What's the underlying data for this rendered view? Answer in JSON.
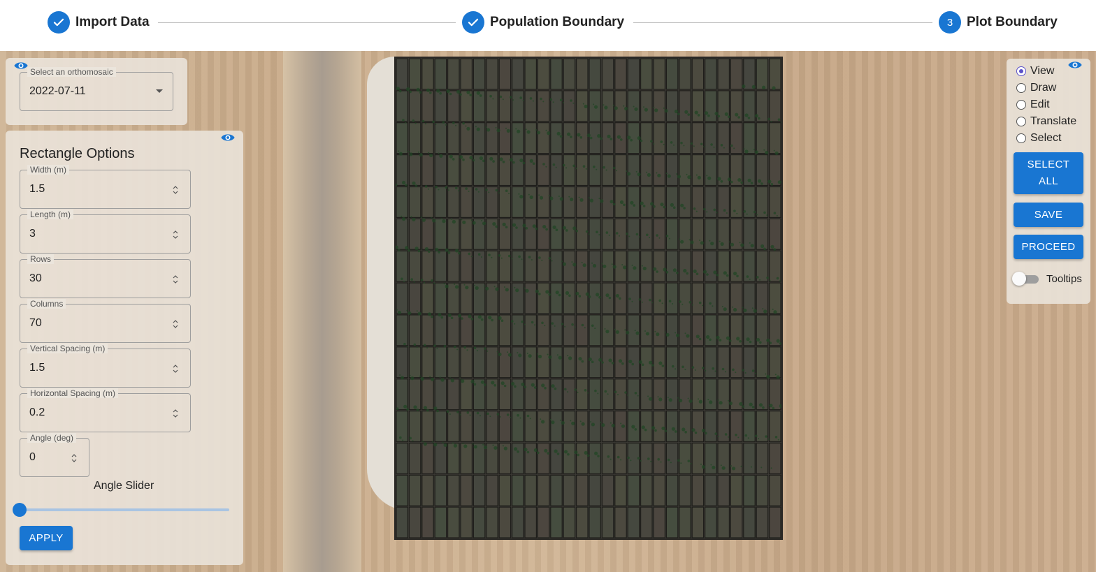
{
  "stepper": {
    "steps": [
      {
        "label": "Import Data",
        "state": "completed"
      },
      {
        "label": "Population Boundary",
        "state": "completed"
      },
      {
        "label": "Plot Boundary",
        "state": "active",
        "number": "3"
      }
    ]
  },
  "orthomosaic": {
    "label": "Select an orthomosaic",
    "value": "2022-07-11"
  },
  "rectangle_options": {
    "title": "Rectangle Options",
    "fields": [
      {
        "label": "Width (m)",
        "value": "1.5"
      },
      {
        "label": "Length (m)",
        "value": "3"
      },
      {
        "label": "Rows",
        "value": "30"
      },
      {
        "label": "Columns",
        "value": "70"
      },
      {
        "label": "Vertical Spacing (m)",
        "value": "1.5"
      },
      {
        "label": "Horizontal Spacing (m)",
        "value": "0.2"
      },
      {
        "label": "Angle (deg)",
        "value": "0"
      }
    ],
    "slider_label": "Angle Slider",
    "slider_value": 0,
    "apply_label": "APPLY"
  },
  "mode_panel": {
    "modes": [
      {
        "label": "View",
        "checked": true
      },
      {
        "label": "Draw",
        "checked": false
      },
      {
        "label": "Edit",
        "checked": false
      },
      {
        "label": "Translate",
        "checked": false
      },
      {
        "label": "Select",
        "checked": false
      }
    ],
    "select_all_label": "SELECT ALL",
    "save_label": "SAVE",
    "proceed_label": "PROCEED",
    "tooltips_label": "Tooltips",
    "tooltips_on": false
  },
  "colors": {
    "accent": "#1976d2",
    "radio_checked": "#5b52c8"
  }
}
